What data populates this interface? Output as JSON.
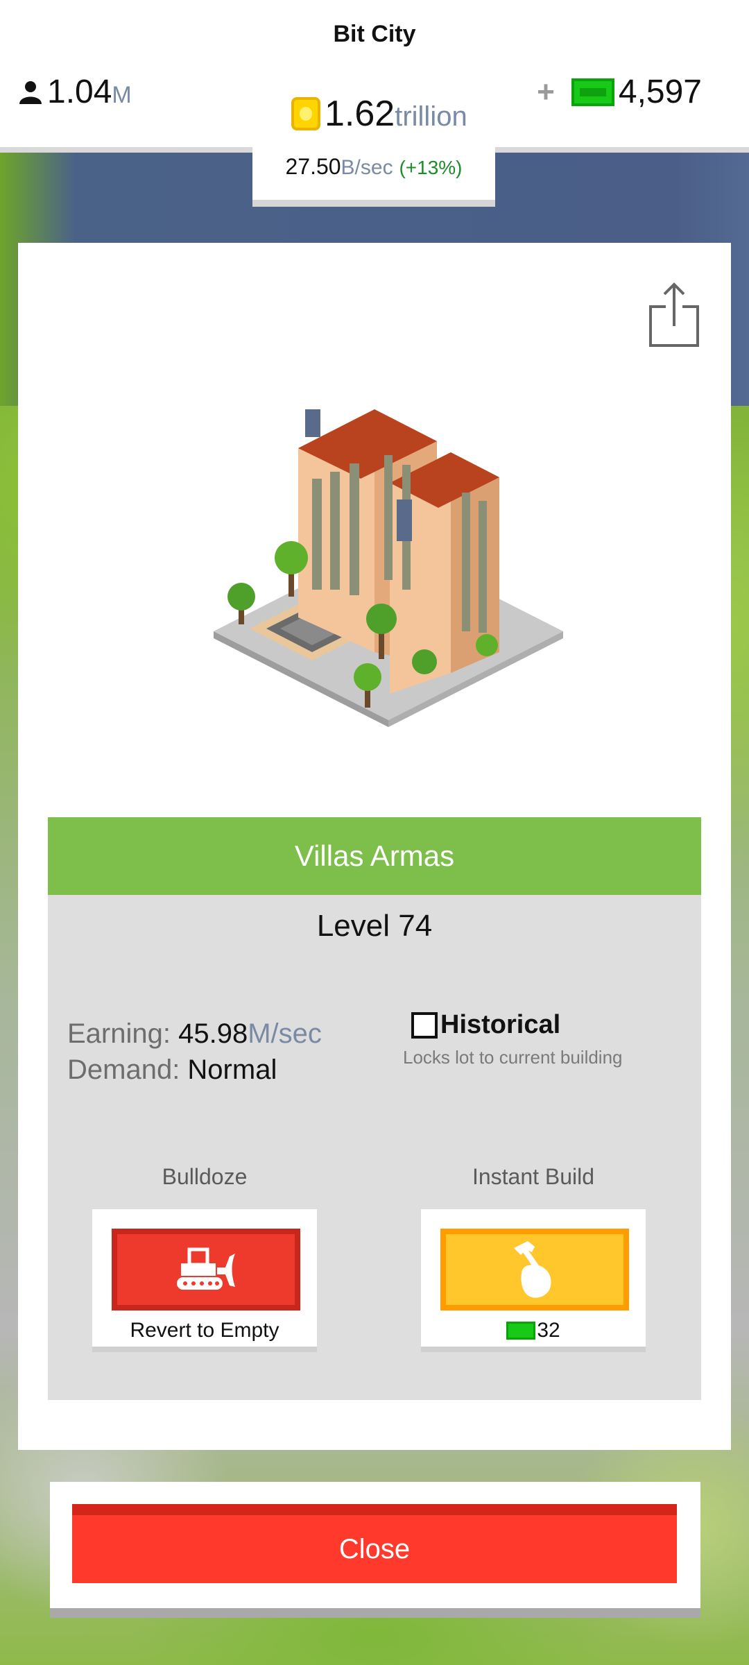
{
  "app": {
    "title": "Bit City"
  },
  "stats_bar": {
    "population_value": "1.04",
    "population_unit": "M",
    "cash_value": "4,597",
    "cash_plus": "+",
    "coins_value": "1.62",
    "coins_unit": "trillion",
    "rate_value": "27.50",
    "rate_unit": "B/sec",
    "rate_change": "(+13%)"
  },
  "building": {
    "name": "Villas Armas",
    "level": "Level 74",
    "earning_label": "Earning: ",
    "earning_value": "45.98",
    "earning_unit": "M/sec",
    "demand_label": "Demand: ",
    "demand_value": "Normal",
    "historical_label": "Historical",
    "historical_sub": "Locks lot to current building",
    "historical_checked": false
  },
  "actions": {
    "bulldoze_label": "Bulldoze",
    "bulldoze_caption": "Revert to Empty",
    "instant_label": "Instant Build",
    "instant_cost": "32"
  },
  "close_label": "Close",
  "icons": {
    "population": "person-icon",
    "cash": "cash-bill-icon",
    "coin": "coin-icon",
    "share": "share-icon",
    "bulldozer": "bulldozer-icon",
    "hammer": "hammer-hand-icon"
  },
  "colors": {
    "name_bar": "#7dbf4a",
    "bulldoze": "#ee3a2c",
    "instant": "#ffc72b",
    "close": "#ff3a2c"
  }
}
